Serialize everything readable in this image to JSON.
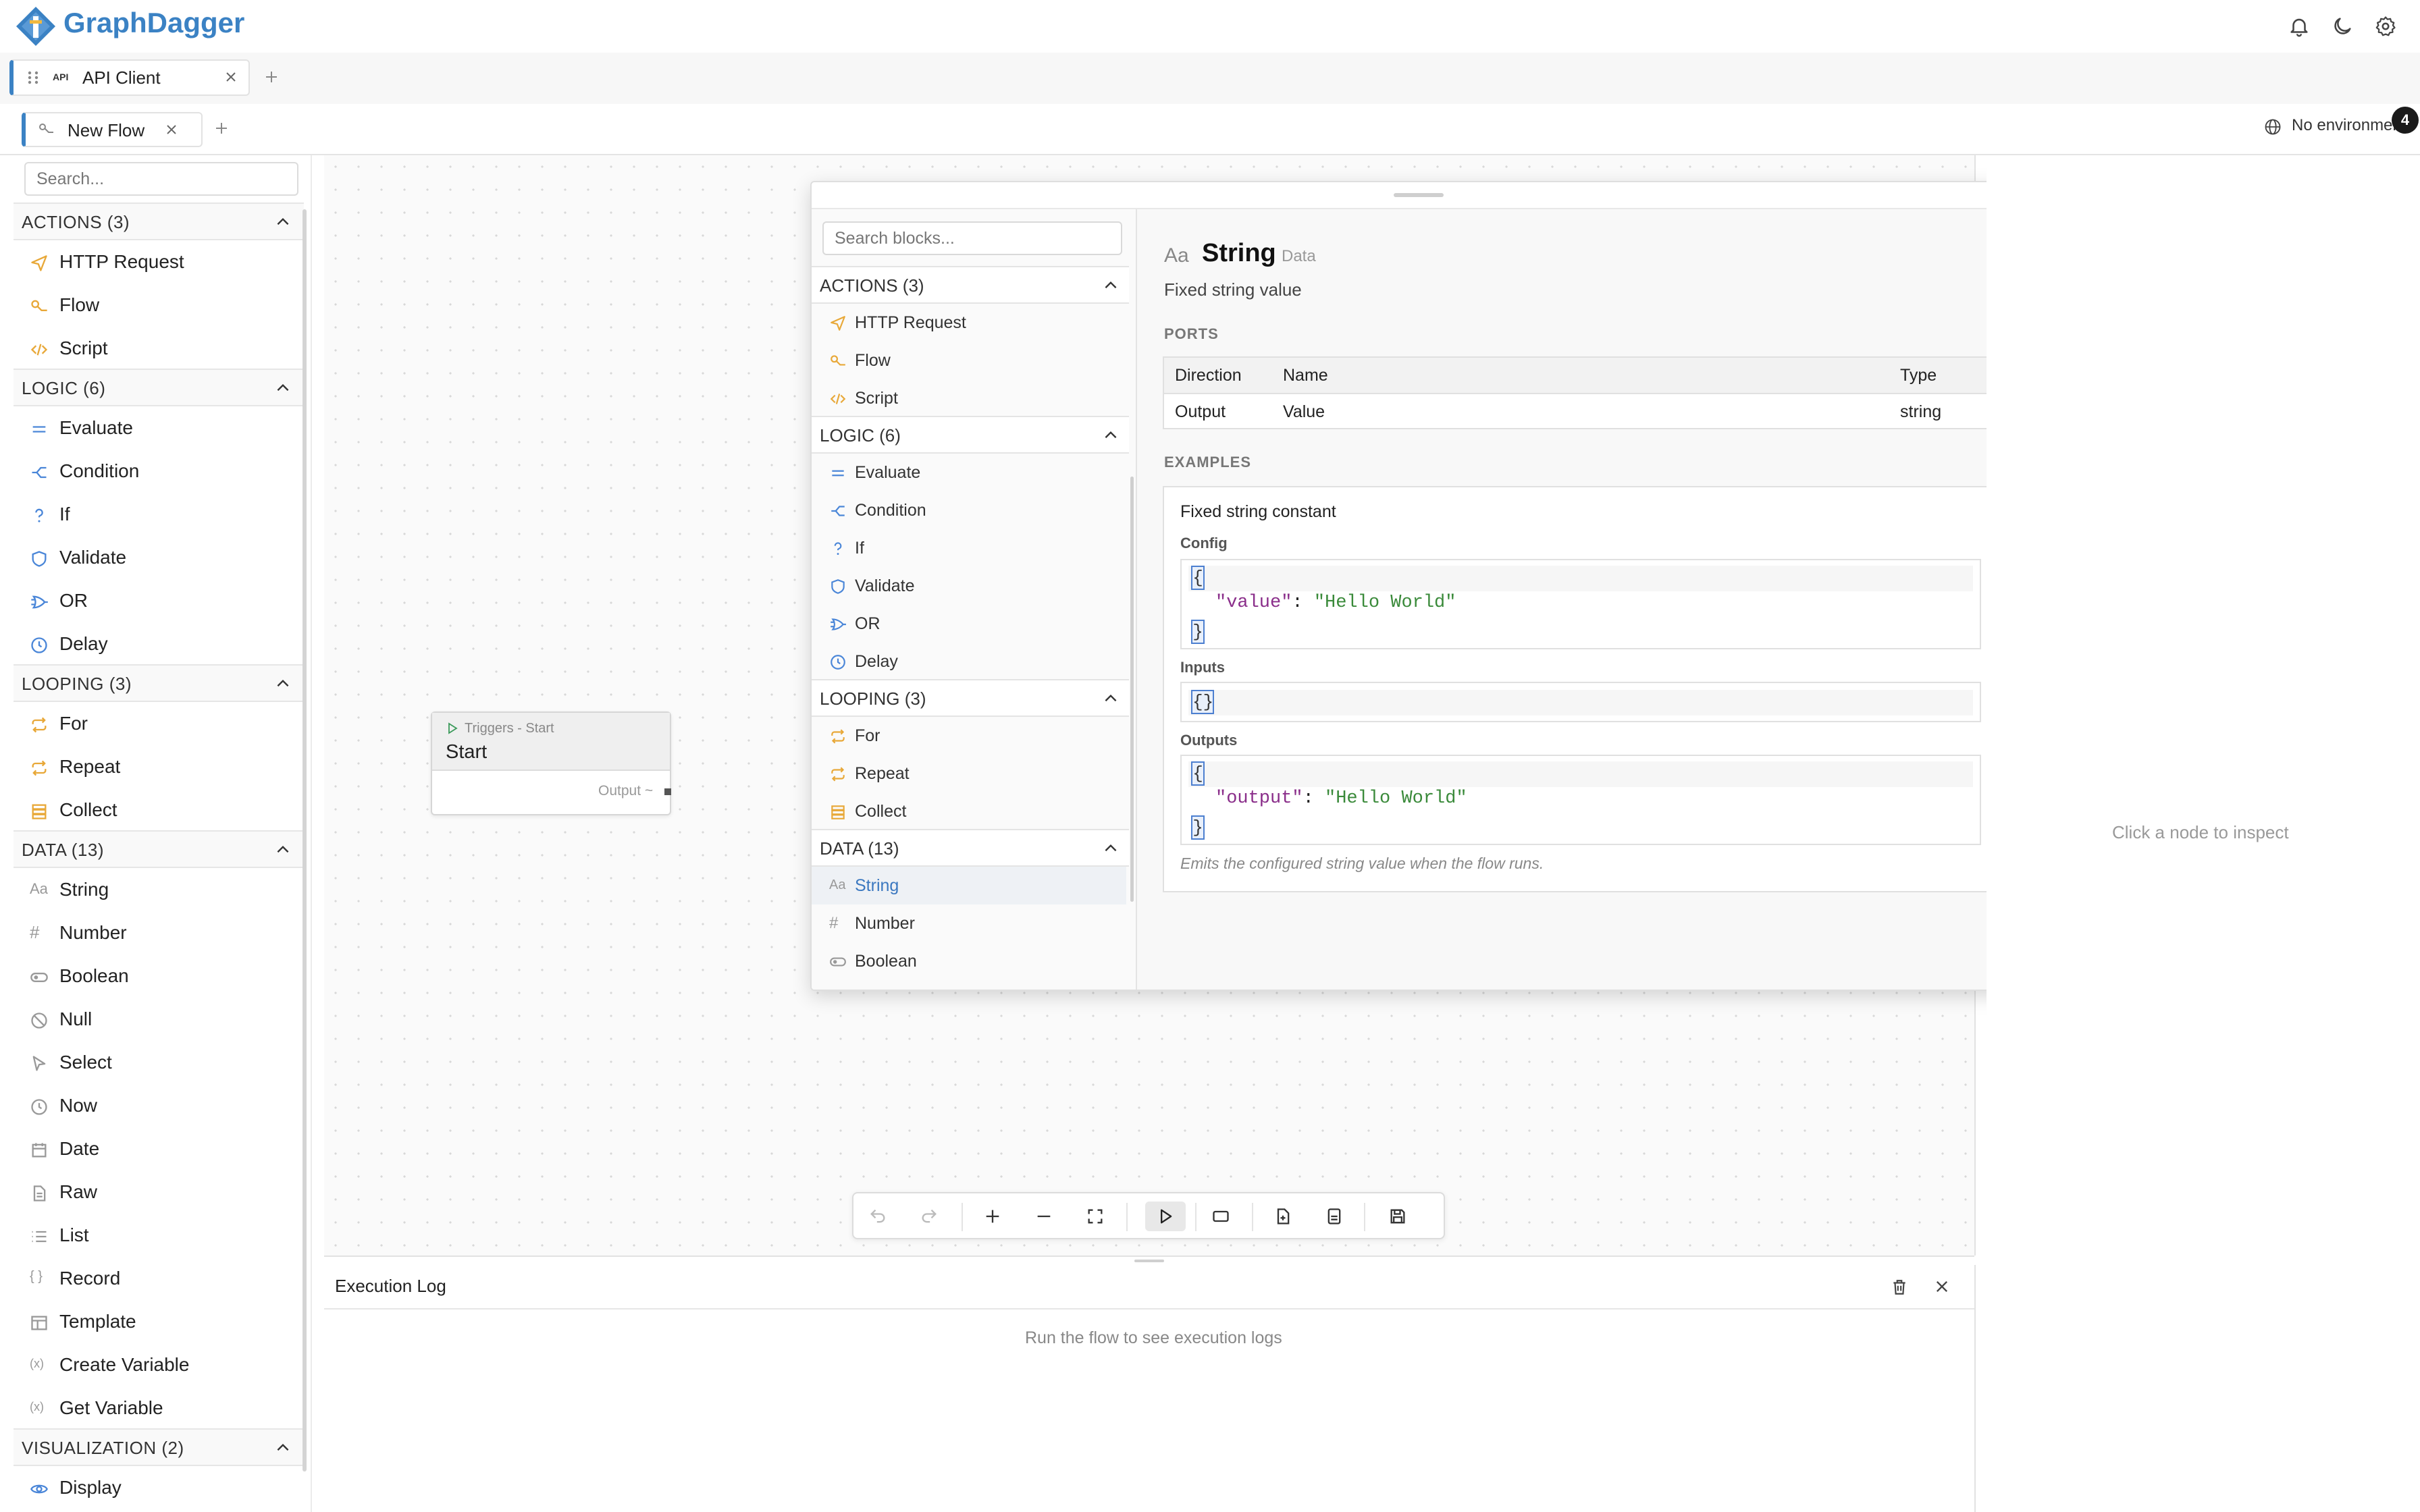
{
  "app": {
    "name": "GraphDagger"
  },
  "tabs_primary": [
    {
      "label": "API Client",
      "icon_text": "API"
    }
  ],
  "tabs_secondary": [
    {
      "label": "New Flow"
    }
  ],
  "environment": {
    "label": "No environment",
    "badge": "4"
  },
  "sidebar": {
    "search_placeholder": "Search...",
    "sections": [
      {
        "title": "ACTIONS (3)",
        "items": [
          "HTTP Request",
          "Flow",
          "Script"
        ]
      },
      {
        "title": "LOGIC (6)",
        "items": [
          "Evaluate",
          "Condition",
          "If",
          "Validate",
          "OR",
          "Delay"
        ]
      },
      {
        "title": "LOOPING (3)",
        "items": [
          "For",
          "Repeat",
          "Collect"
        ]
      },
      {
        "title": "DATA (13)",
        "items": [
          "String",
          "Number",
          "Boolean",
          "Null",
          "Select",
          "Now",
          "Date",
          "Raw",
          "List",
          "Record",
          "Template",
          "Create Variable",
          "Get Variable"
        ]
      },
      {
        "title": "VISUALIZATION (2)",
        "items": [
          "Display"
        ]
      }
    ]
  },
  "canvas": {
    "start_node": {
      "category": "Triggers - Start",
      "title": "Start",
      "output_label": "Output ~"
    }
  },
  "palette": {
    "search_placeholder": "Search blocks...",
    "sections": [
      {
        "title": "ACTIONS (3)",
        "items": [
          "HTTP Request",
          "Flow",
          "Script"
        ]
      },
      {
        "title": "LOGIC (6)",
        "items": [
          "Evaluate",
          "Condition",
          "If",
          "Validate",
          "OR",
          "Delay"
        ]
      },
      {
        "title": "LOOPING (3)",
        "items": [
          "For",
          "Repeat",
          "Collect"
        ]
      },
      {
        "title": "DATA (13)",
        "items": [
          "String",
          "Number",
          "Boolean"
        ]
      }
    ],
    "selected_item": "String",
    "detail": {
      "title": "String",
      "category": "Data",
      "description": "Fixed string value",
      "ports_label": "PORTS",
      "ports_columns": [
        "Direction",
        "Name",
        "Type"
      ],
      "ports_rows": [
        {
          "direction": "Output",
          "name": "Value",
          "type": "string"
        }
      ],
      "examples_label": "EXAMPLES",
      "example": {
        "title": "Fixed string constant",
        "config_label": "Config",
        "config_key": "\"value\"",
        "config_value": "\"Hello World\"",
        "inputs_label": "Inputs",
        "inputs_value": "{}",
        "outputs_label": "Outputs",
        "outputs_key": "\"output\"",
        "outputs_value": "\"Hello World\"",
        "note": "Emits the configured string value when the flow runs."
      }
    }
  },
  "execution_log": {
    "title": "Execution Log",
    "empty_text": "Run the flow to see execution logs"
  },
  "inspector": {
    "empty_text": "Click a node to inspect"
  },
  "colors": {
    "accent": "#3b82c4",
    "action_icon": "#e8a838",
    "logic_icon": "#4a86d8",
    "loop_icon": "#e8a838"
  }
}
